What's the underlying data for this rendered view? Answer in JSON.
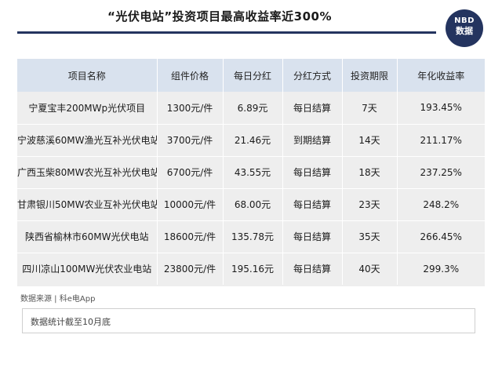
{
  "header": {
    "title": "“光伏电站”投资项目最高收益率近300%",
    "logo_top": "NBD",
    "logo_bottom": "数据"
  },
  "table": {
    "columns": [
      "项目名称",
      "组件价格",
      "每日分红",
      "分红方式",
      "投资期限",
      "年化收益率"
    ],
    "rows": [
      [
        "宁夏宝丰200MWp光伏项目",
        "1300元/件",
        "6.89元",
        "每日结算",
        "7天",
        "193.45%"
      ],
      [
        "宁波慈溪60MW渔光互补光伏电站",
        "3700元/件",
        "21.46元",
        "到期结算",
        "14天",
        "211.17%"
      ],
      [
        "广西玉柴80MW农光互补光伏电站",
        "6700元/件",
        "43.55元",
        "每日结算",
        "18天",
        "237.25%"
      ],
      [
        "甘肃银川50MW农业互补光伏电站",
        "10000元/件",
        "68.00元",
        "每日结算",
        "23天",
        "248.2%"
      ],
      [
        "陕西省榆林市60MW光伏电站",
        "18600元/件",
        "135.78元",
        "每日结算",
        "35天",
        "266.45%"
      ],
      [
        "四川凉山100MW光伏农业电站",
        "23800元/件",
        "195.16元",
        "每日结算",
        "40天",
        "299.3%"
      ]
    ]
  },
  "footer": {
    "source": "数据来源 | 科e电App",
    "note": "数据统计截至10月底"
  },
  "colors": {
    "accent": "#24345f",
    "header_bg": "#d9e2ee",
    "row_bg": "#eeeeee"
  }
}
